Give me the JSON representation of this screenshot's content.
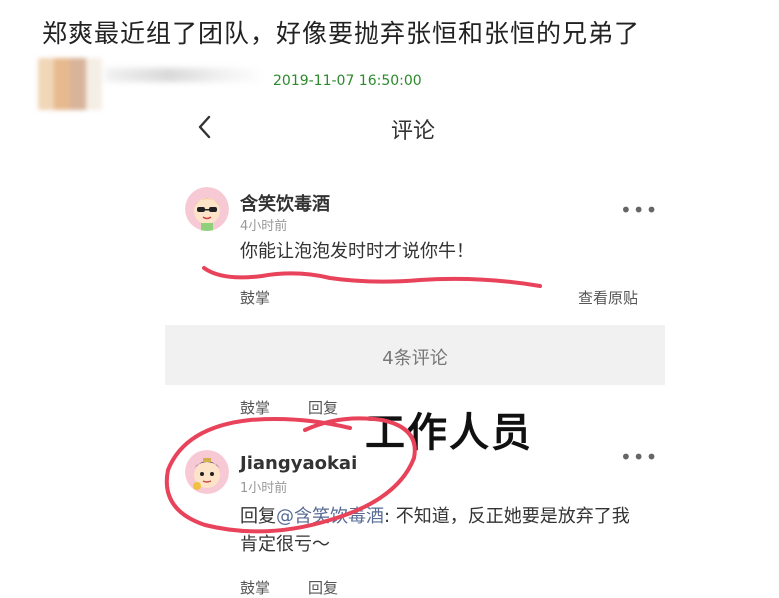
{
  "headline": "郑爽最近组了团队，好像要抛弃张恒和张恒的兄弟了",
  "post_timestamp": "2019-11-07 16:50:00",
  "nav": {
    "back_icon": "chevron-left-icon",
    "title": "评论"
  },
  "main_comment": {
    "author": "含笑饮毒酒",
    "time": "4小时前",
    "text": "你能让泡泡发时时才说你牛！",
    "more_icon": "•••",
    "like_label": "鼓掌",
    "view_original_label": "查看原贴"
  },
  "comment_count_label": "4条评论",
  "mid_actions": {
    "like_label": "鼓掌",
    "reply_label": "回复"
  },
  "annotation_label": "工作人员",
  "reply": {
    "author": "Jiangyaokai",
    "time": "1小时前",
    "prefix": "回复",
    "mention": "@含笑饮毒酒",
    "text": ": 不知道，反正她要是放弃了我肯定很亏～",
    "more_icon": "•••",
    "like_label": "鼓掌",
    "reply_label": "回复"
  },
  "colors": {
    "timestamp": "#2b8a2b",
    "scribble": "#e8435a",
    "mention": "#576b95"
  }
}
